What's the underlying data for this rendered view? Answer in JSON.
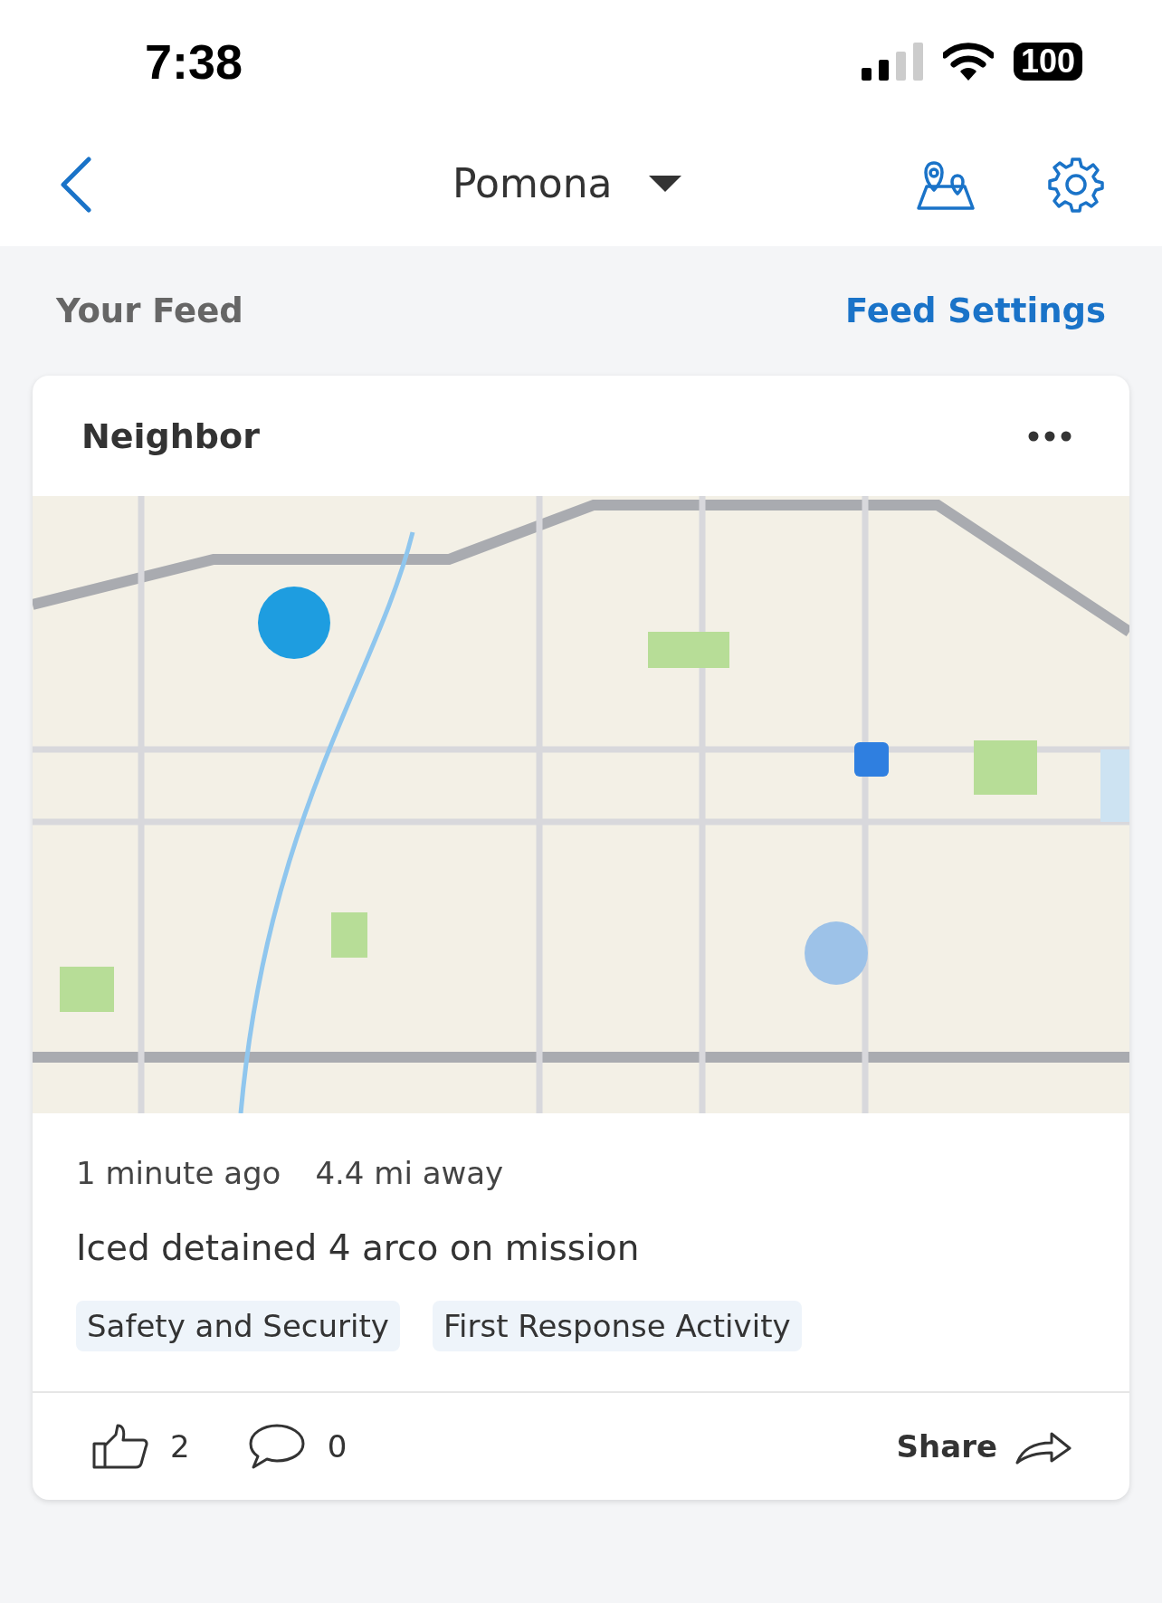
{
  "status_bar": {
    "time": "7:38",
    "battery": "100"
  },
  "header": {
    "location": "Pomona"
  },
  "feed": {
    "title": "Your Feed",
    "settings_link": "Feed Settings"
  },
  "post": {
    "category": "Neighbor",
    "time_ago": "1 minute ago",
    "distance": "4.4 mi away",
    "text": "Iced detained 4 arco on mission",
    "tags": [
      {
        "label": "Safety and Security"
      },
      {
        "label": "First Response Activity"
      }
    ],
    "likes": "2",
    "comments": "0",
    "share": "Share"
  }
}
